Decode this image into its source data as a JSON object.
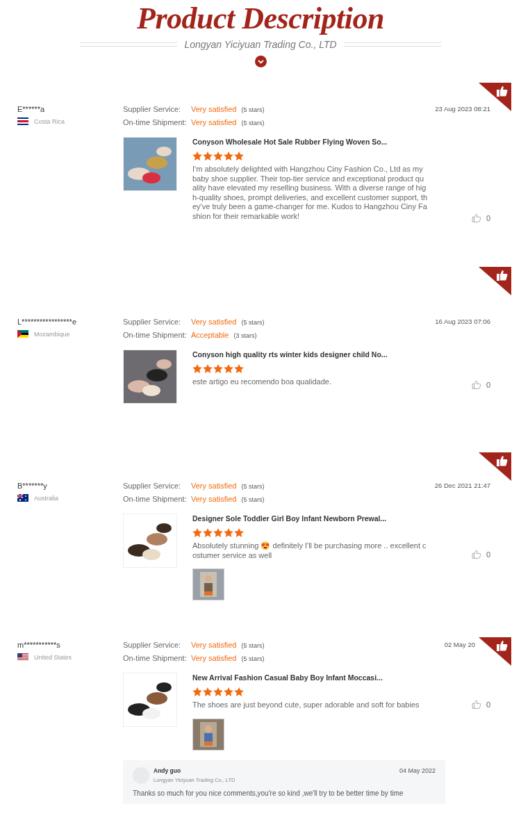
{
  "header": {
    "title": "Product Description",
    "subtitle": "Longyan Yiciyuan Trading Co., LTD"
  },
  "reviews": [
    {
      "name": "E******a",
      "country": "Costa Rica",
      "flag": {
        "kind": "costa-rica"
      },
      "date": "23 Aug 2023 08:21",
      "ratings": [
        {
          "label": "Supplier Service:",
          "value": "Very satisfied",
          "note": "(5 stars)"
        },
        {
          "label": "On-time Shipment:",
          "value": "Very satisfied",
          "note": "(5 stars)"
        }
      ],
      "product": {
        "title": "Conyson Wholesale Hot Sale Rubber Flying Woven So...",
        "stars": 5,
        "comment": "I'm absolutely delighted with Hangzhou Ciny Fashion Co., Ltd as my baby shoe supplier. Their top-tier service and exceptional product quality have elevated my reselling business. With a diverse range of high-quality shoes, prompt deliveries, and excellent customer support, they've truly been a game-changer for me. Kudos to Hangzhou Ciny Fashion for their remarkable work!"
      },
      "helpful": "0"
    },
    {
      "name": "L*****************e",
      "country": "Mozambique",
      "flag": {
        "kind": "mozambique"
      },
      "date": "16 Aug 2023 07:06",
      "ratings": [
        {
          "label": "Supplier Service:",
          "value": "Very satisfied",
          "note": "(5 stars)"
        },
        {
          "label": "On-time Shipment:",
          "value": "Acceptable",
          "note": "(3 stars)"
        }
      ],
      "product": {
        "title": "Conyson high quality rts winter kids designer child No...",
        "stars": 5,
        "comment": "este artigo eu recomendo boa qualidade."
      },
      "helpful": "0"
    },
    {
      "name": "B*******y",
      "country": "Australia",
      "flag": {
        "kind": "australia"
      },
      "date": "26 Dec 2021 21:47",
      "ratings": [
        {
          "label": "Supplier Service:",
          "value": "Very satisfied",
          "note": "(5 stars)"
        },
        {
          "label": "On-time Shipment:",
          "value": "Very satisfied",
          "note": "(5 stars)"
        }
      ],
      "product": {
        "title": "Designer Sole Toddler Girl Boy Infant Newborn Prewal...",
        "stars": 5,
        "comment": "Absolutely stunning 😍 definitely I'll be purchasing more .. excellent costumer service as well"
      },
      "helpful": "0"
    },
    {
      "name": "m***********s",
      "country": "United States",
      "flag": {
        "kind": "usa"
      },
      "date": "02 May 20",
      "ratings": [
        {
          "label": "Supplier Service:",
          "value": "Very satisfied",
          "note": "(5 stars)"
        },
        {
          "label": "On-time Shipment:",
          "value": "Very satisfied",
          "note": "(5 stars)"
        }
      ],
      "product": {
        "title": "New Arrival Fashion Casual Baby Boy Infant Moccasi...",
        "stars": 5,
        "comment": "The shoes are just beyond cute, super adorable and soft for babies"
      },
      "helpful": "0",
      "reply": {
        "name": "Andy guo",
        "company": "Longyan Yiciyuan Trading Co., LTD",
        "date": "04 May 2022",
        "text": "Thanks so much for you nice comments,you're so kind ,we'll try to be better time by time"
      }
    }
  ]
}
